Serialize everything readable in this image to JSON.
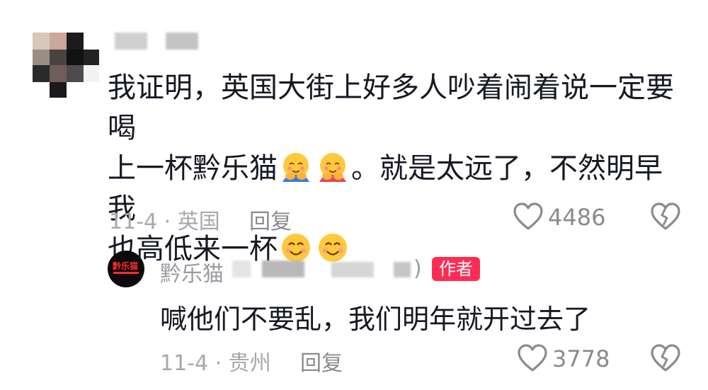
{
  "comment": {
    "lines": [
      "我证明，英国大街上好多人吵着闹着说一定要喝",
      "上一杯黔乐猫",
      "。就是太远了，不然明早我",
      "也高低来一杯"
    ],
    "emojis": [
      "hug-emoji",
      "hug-emoji",
      "smile-emoji",
      "smile-emoji"
    ],
    "date_location": "11-4 · 英国",
    "reply_label": "回复",
    "like_count": "4486"
  },
  "reply": {
    "author_name": "黔乐猫",
    "author_suffix": ")",
    "badge": "作者",
    "avatar_text": "黔乐猫",
    "text": "喊他们不要乱，我们明年就开过去了",
    "date_location": "11-4 · 贵州",
    "reply_label": "回复",
    "like_count": "3778"
  },
  "colors": {
    "badge": "#fe2c55",
    "text": "#161823",
    "muted": "#a7a8ab"
  }
}
